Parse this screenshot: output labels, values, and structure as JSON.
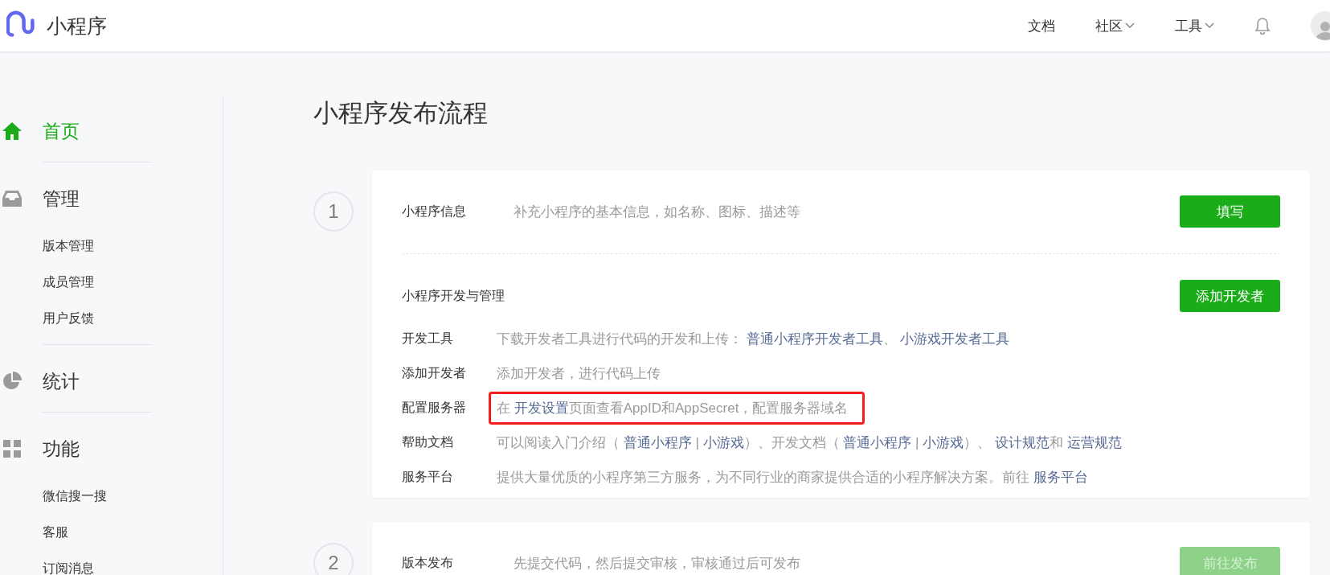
{
  "header": {
    "brand": "小程序",
    "nav": [
      {
        "label": "文档",
        "dropdown": false
      },
      {
        "label": "社区",
        "dropdown": true
      },
      {
        "label": "工具",
        "dropdown": true
      }
    ]
  },
  "sidebar": {
    "sections": [
      {
        "label": "首页",
        "selected": true
      },
      {
        "label": "管理",
        "selected": false,
        "items": [
          "版本管理",
          "成员管理",
          "用户反馈"
        ]
      },
      {
        "label": "统计",
        "selected": false
      },
      {
        "label": "功能",
        "selected": false,
        "items": [
          "微信搜一搜",
          "客服",
          "订阅消息"
        ]
      }
    ]
  },
  "page": {
    "title": "小程序发布流程"
  },
  "steps": [
    {
      "number": "1",
      "head": {
        "label": "小程序信息",
        "description": "补充小程序的基本信息，如名称、图标、描述等",
        "button": {
          "label": "填写",
          "disabled": false
        }
      },
      "section": {
        "title": "小程序开发与管理",
        "button": {
          "label": "添加开发者",
          "disabled": false
        },
        "rows": [
          {
            "label": "开发工具",
            "highlighted": false,
            "parts": [
              {
                "kind": "text",
                "text": "下载开发者工具进行代码的开发和上传： "
              },
              {
                "kind": "link",
                "text": "普通小程序开发者工具"
              },
              {
                "kind": "text",
                "text": "、 "
              },
              {
                "kind": "link",
                "text": "小游戏开发者工具"
              }
            ]
          },
          {
            "label": "添加开发者",
            "highlighted": false,
            "parts": [
              {
                "kind": "text",
                "text": "添加开发者，进行代码上传"
              }
            ]
          },
          {
            "label": "配置服务器",
            "highlighted": true,
            "parts": [
              {
                "kind": "text",
                "text": "在 "
              },
              {
                "kind": "link",
                "text": "开发设置"
              },
              {
                "kind": "text",
                "text": "页面查看AppID和AppSecret，配置服务器域名"
              }
            ]
          },
          {
            "label": "帮助文档",
            "highlighted": false,
            "parts": [
              {
                "kind": "text",
                "text": "可以阅读入门介绍（ "
              },
              {
                "kind": "link",
                "text": "普通小程序"
              },
              {
                "kind": "text",
                "text": " | "
              },
              {
                "kind": "link",
                "text": "小游戏"
              },
              {
                "kind": "text",
                "text": "）、开发文档（ "
              },
              {
                "kind": "link",
                "text": "普通小程序"
              },
              {
                "kind": "text",
                "text": " | "
              },
              {
                "kind": "link",
                "text": "小游戏"
              },
              {
                "kind": "text",
                "text": "）、 "
              },
              {
                "kind": "link",
                "text": "设计规范"
              },
              {
                "kind": "text",
                "text": "和 "
              },
              {
                "kind": "link",
                "text": "运营规范"
              }
            ]
          },
          {
            "label": "服务平台",
            "highlighted": false,
            "parts": [
              {
                "kind": "text",
                "text": "提供大量优质的小程序第三方服务，为不同行业的商家提供合适的小程序解决方案。前往 "
              },
              {
                "kind": "link",
                "text": "服务平台"
              }
            ]
          }
        ]
      }
    },
    {
      "number": "2",
      "head": {
        "label": "版本发布",
        "description": "先提交代码，然后提交审核，审核通过后可发布",
        "button": {
          "label": "前往发布",
          "disabled": true
        }
      }
    }
  ]
}
